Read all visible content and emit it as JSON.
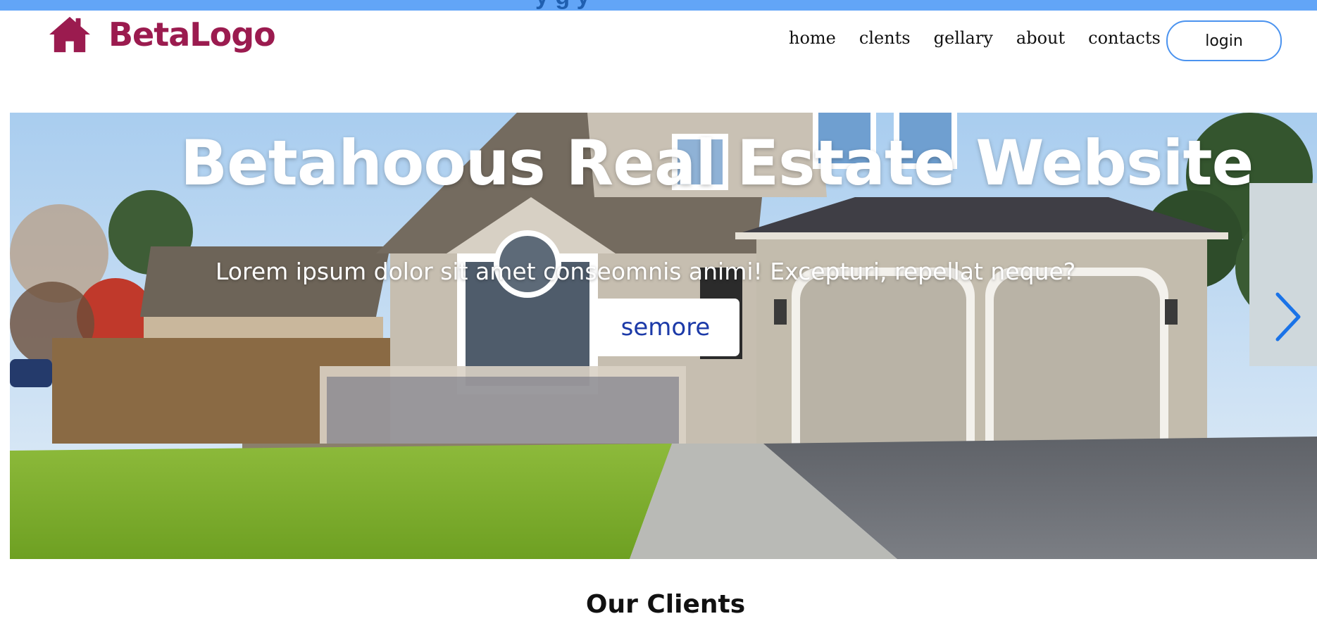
{
  "header": {
    "brand": "BetaLogo",
    "nav": [
      "home",
      "clents",
      "gellary",
      "about",
      "contacts"
    ],
    "login_label": "login",
    "icons": {
      "brand": "home-icon"
    }
  },
  "hero": {
    "title": "Betahoous Real Estate Website",
    "subtitle": "Lorem ipsum dolor sit amet conseomnis animi! Excepturi, repellat neque?",
    "button_label": "semore",
    "icons": {
      "next": "chevron-right-icon"
    }
  },
  "clients": {
    "title": "Our Clients"
  },
  "colors": {
    "top_strip": "#62a5f7",
    "brand": "#9b1b4f",
    "login_border": "#4b93ef",
    "hero_button_text": "#1c3aa8",
    "carousel_arrow": "#1a73e8"
  }
}
